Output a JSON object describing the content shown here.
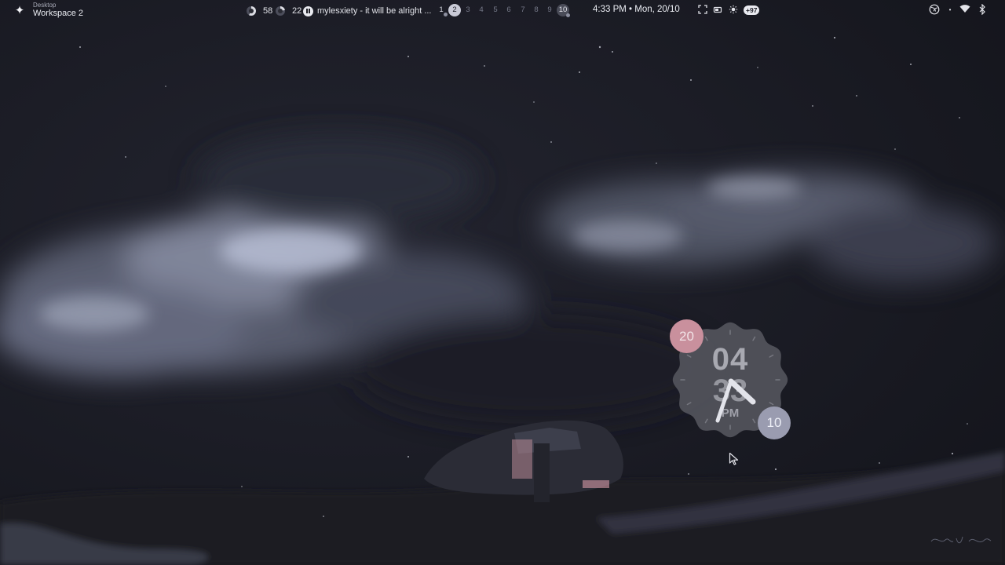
{
  "workspace": {
    "label_small": "Desktop",
    "label": "Workspace 2"
  },
  "launcher_icon": "sparkle-icon",
  "resources": {
    "cpu": "58",
    "memory": "22"
  },
  "media": {
    "title": "mylesxiety - it will be alright ...",
    "state_icon": "pause-icon"
  },
  "workspaces": {
    "items": [
      "1",
      "2",
      "3",
      "4",
      "5",
      "6",
      "7",
      "8",
      "9",
      "10"
    ],
    "active": "2"
  },
  "clock": {
    "text": "4:33 PM • Mon, 20/10"
  },
  "system": {
    "icons": [
      "screenshot-icon",
      "battery-icon",
      "brightness-icon"
    ],
    "badge": "+97"
  },
  "tray": {
    "icons": [
      "browser-icon",
      "dot-separator",
      "wifi-icon",
      "bluetooth-icon"
    ]
  },
  "clock_widget": {
    "hour": "04",
    "minute": "33",
    "ampm": "PM",
    "day": "20",
    "month": "10"
  },
  "colors": {
    "background": "#16171f",
    "widget_face": "#55565e",
    "day_badge": "#c9909d",
    "month_badge": "#9a9cb0"
  }
}
